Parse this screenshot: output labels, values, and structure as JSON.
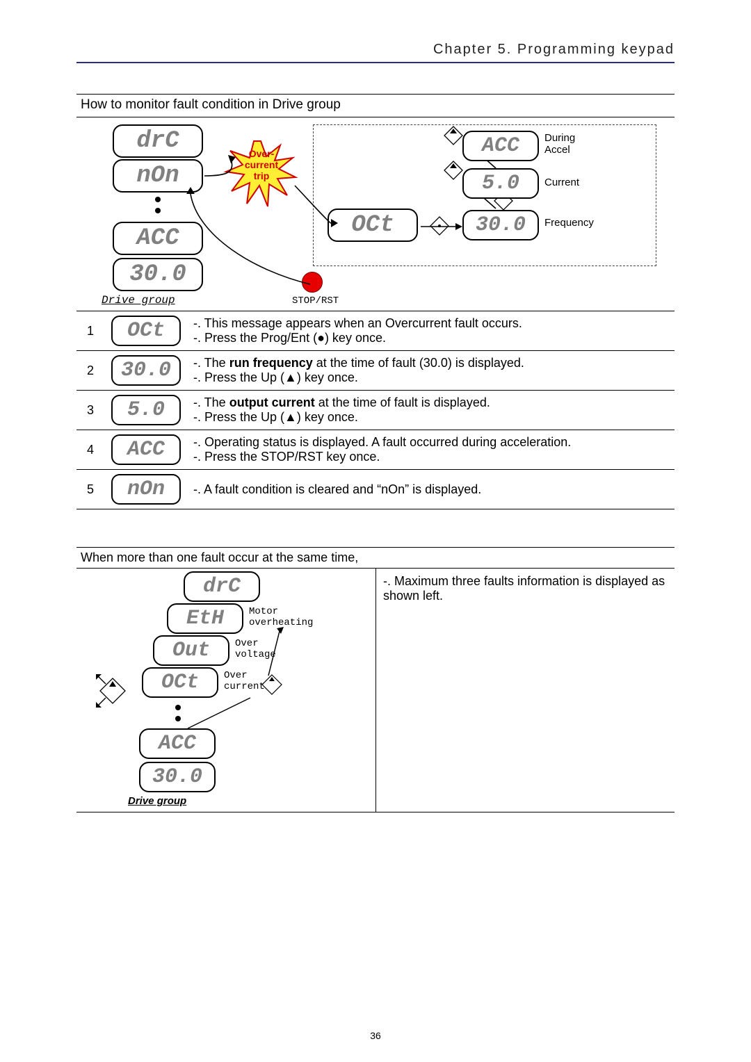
{
  "header": "Chapter 5. Programming keypad",
  "section1_caption": "How to monitor fault condition in Drive group",
  "lcd": {
    "drc": "drC",
    "non": "nOn",
    "acc": "ACC",
    "v300": "30.0",
    "oct": "OCt",
    "v50": "5.0"
  },
  "burst_lines": [
    "Over-",
    "current",
    "trip"
  ],
  "stop_label": "STOP/RST",
  "drive_group_label": "Drive group",
  "callout_labels": {
    "accel1": "During",
    "accel2": "Accel",
    "current": "Current",
    "freq": "Frequency"
  },
  "steps": [
    {
      "num": "1",
      "lcd": "OCt",
      "desc": [
        "-. This message appears when an Overcurrent fault occurs.",
        "-. Press the Prog/Ent (●) key once."
      ]
    },
    {
      "num": "2",
      "lcd": "30.0",
      "desc": [
        "-. The <b>run frequency</b> at the time of fault (30.0) is displayed.",
        "-. Press the Up (▲) key once."
      ]
    },
    {
      "num": "3",
      "lcd": "5.0",
      "desc": [
        "-. The <b>output current</b> at the time of fault is displayed.",
        "-. Press the Up (▲) key once."
      ]
    },
    {
      "num": "4",
      "lcd": "ACC",
      "desc": [
        "-. Operating status is displayed. A fault occurred during acceleration.",
        "-. Press the STOP/RST key once."
      ]
    },
    {
      "num": "5",
      "lcd": "nOn",
      "desc": [
        "-. A fault condition is cleared and “nOn” is displayed."
      ]
    }
  ],
  "section2_caption": "When more than one fault occur at the same time,",
  "multi": {
    "lcd": {
      "drc": "drC",
      "eth": "EtH",
      "out": "Out",
      "oct": "OCt",
      "acc": "ACC",
      "v300": "30.0"
    },
    "labels": {
      "eth": "Motor\noverheating",
      "out": "Over\nvoltage",
      "oct": "Over\ncurrent"
    },
    "right": "-. Maximum three faults information is displayed as shown left."
  },
  "page_number": "36"
}
